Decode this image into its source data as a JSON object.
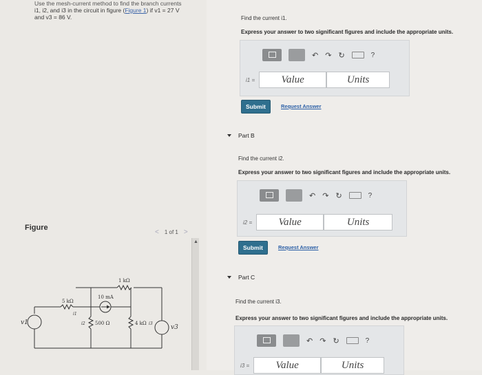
{
  "problem": {
    "line1": "Use the mesh-current method to find the branch currents",
    "line2_pre": "i1, i2, and i3 in the circuit in figure (",
    "figure_link": "Figure 1",
    "line2_post": ") if v1 = 27 V",
    "line3": "and v3 = 86 V."
  },
  "figure": {
    "label": "Figure",
    "pager": "1 of 1",
    "prev": "<",
    "next": ">",
    "circuit": {
      "r_top": "1 kΩ",
      "r_left": "5 kΩ",
      "source_current": "10 mA",
      "r_500": "500 Ω",
      "r_4k": "4 kΩ",
      "v1": "v1",
      "v3": "v3",
      "i1": "i1",
      "i2": "i2",
      "i3": "i3"
    }
  },
  "part_a": {
    "prompt": "Find the current i1.",
    "instruction": "Express your answer to two significant figures and include the appropriate units.",
    "var": "i1 =",
    "value_placeholder": "Value",
    "units_placeholder": "Units",
    "submit": "Submit",
    "request": "Request Answer"
  },
  "part_b": {
    "title": "Part B",
    "prompt": "Find the current i2.",
    "instruction": "Express your answer to two significant figures and include the appropriate units.",
    "var": "i2 =",
    "value_placeholder": "Value",
    "units_placeholder": "Units",
    "submit": "Submit",
    "request": "Request Answer"
  },
  "part_c": {
    "title": "Part C",
    "prompt": "Find the current i3.",
    "instruction": "Express your answer to two significant figures and include the appropriate units.",
    "var": "i3 =",
    "value_placeholder": "Value",
    "units_placeholder": "Units"
  },
  "toolbar": {
    "help": "?"
  }
}
